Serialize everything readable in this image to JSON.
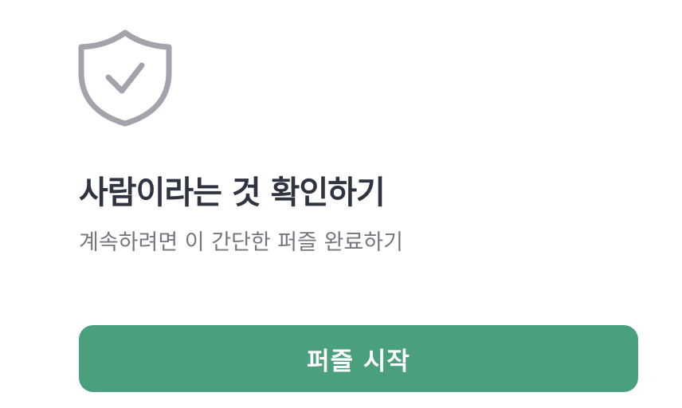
{
  "icons": {
    "header": "shield-check-icon"
  },
  "colors": {
    "icon": "#a4a3ab",
    "title": "#2f3440",
    "subtitle": "#75777e",
    "button_background": "#4aa07e",
    "button_text": "#ffffff"
  },
  "content": {
    "title": "사람이라는 것 확인하기",
    "subtitle": "계속하려면 이 간단한 퍼즐 완료하기",
    "start_button_label": "퍼즐 시작"
  }
}
